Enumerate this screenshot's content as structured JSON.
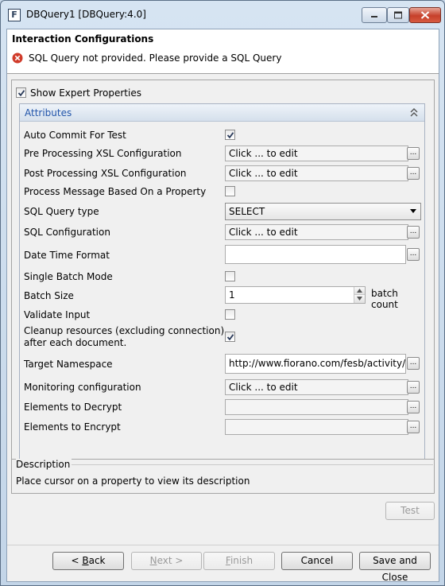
{
  "window": {
    "title": "DBQuery1 [DBQuery:4.0]",
    "app_icon_letter": "F",
    "controls": [
      "minimize-icon",
      "maximize-icon",
      "close-icon"
    ]
  },
  "header": {
    "title": "Interaction Configurations",
    "error_message": "SQL Query not provided. Please provide a SQL Query",
    "error_icon": "error-icon"
  },
  "expert": {
    "label": "Show Expert Properties",
    "checked": true
  },
  "attributes": {
    "title": "Attributes",
    "collapse_icon": "double-chevron-up-icon",
    "rows": {
      "auto_commit": {
        "label": "Auto Commit For Test",
        "checked": true
      },
      "pre_xsl": {
        "label": "Pre Processing XSL Configuration",
        "value": "Click ... to edit"
      },
      "post_xsl": {
        "label": "Post Processing XSL Configuration",
        "value": "Click ... to edit"
      },
      "process_msg": {
        "label": "Process Message Based On a Property",
        "checked": false
      },
      "sql_query_type": {
        "label": "SQL Query type",
        "value": "SELECT"
      },
      "sql_config": {
        "label": "SQL Configuration",
        "value": "Click ... to edit"
      },
      "date_time_format": {
        "label": "Date Time Format",
        "value": ""
      },
      "single_batch": {
        "label": "Single Batch Mode",
        "checked": false
      },
      "batch_size": {
        "label": "Batch Size",
        "value": "1",
        "suffix": "batch count"
      },
      "validate_input": {
        "label": "Validate Input",
        "checked": false
      },
      "cleanup": {
        "label_line1": "Cleanup resources (excluding connection)",
        "label_line2": "after each document.",
        "checked": true
      },
      "target_ns": {
        "label": "Target Namespace",
        "value": "http://www.fiorano.com/fesb/activity/DB"
      },
      "monitoring": {
        "label": "Monitoring configuration",
        "value": "Click ... to edit"
      },
      "decrypt": {
        "label": "Elements to Decrypt",
        "value": ""
      },
      "encrypt": {
        "label": "Elements to Encrypt",
        "value": ""
      }
    },
    "dots_label": "..."
  },
  "description": {
    "title": "Description",
    "text": "Place cursor on a property to view its description"
  },
  "buttons": {
    "test": "Test",
    "back_mnemonic": "B",
    "back_rest": "ack",
    "back_prefix": "< ",
    "next_mnemonic": "N",
    "next_rest": "ext >",
    "finish_mnemonic": "F",
    "finish_rest": "inish",
    "cancel": "Cancel",
    "save_close": "Save and Close"
  },
  "colors": {
    "accent_header": "#2255aa",
    "error_red": "#d03b2a",
    "window_frame": "#c9d9ea"
  }
}
